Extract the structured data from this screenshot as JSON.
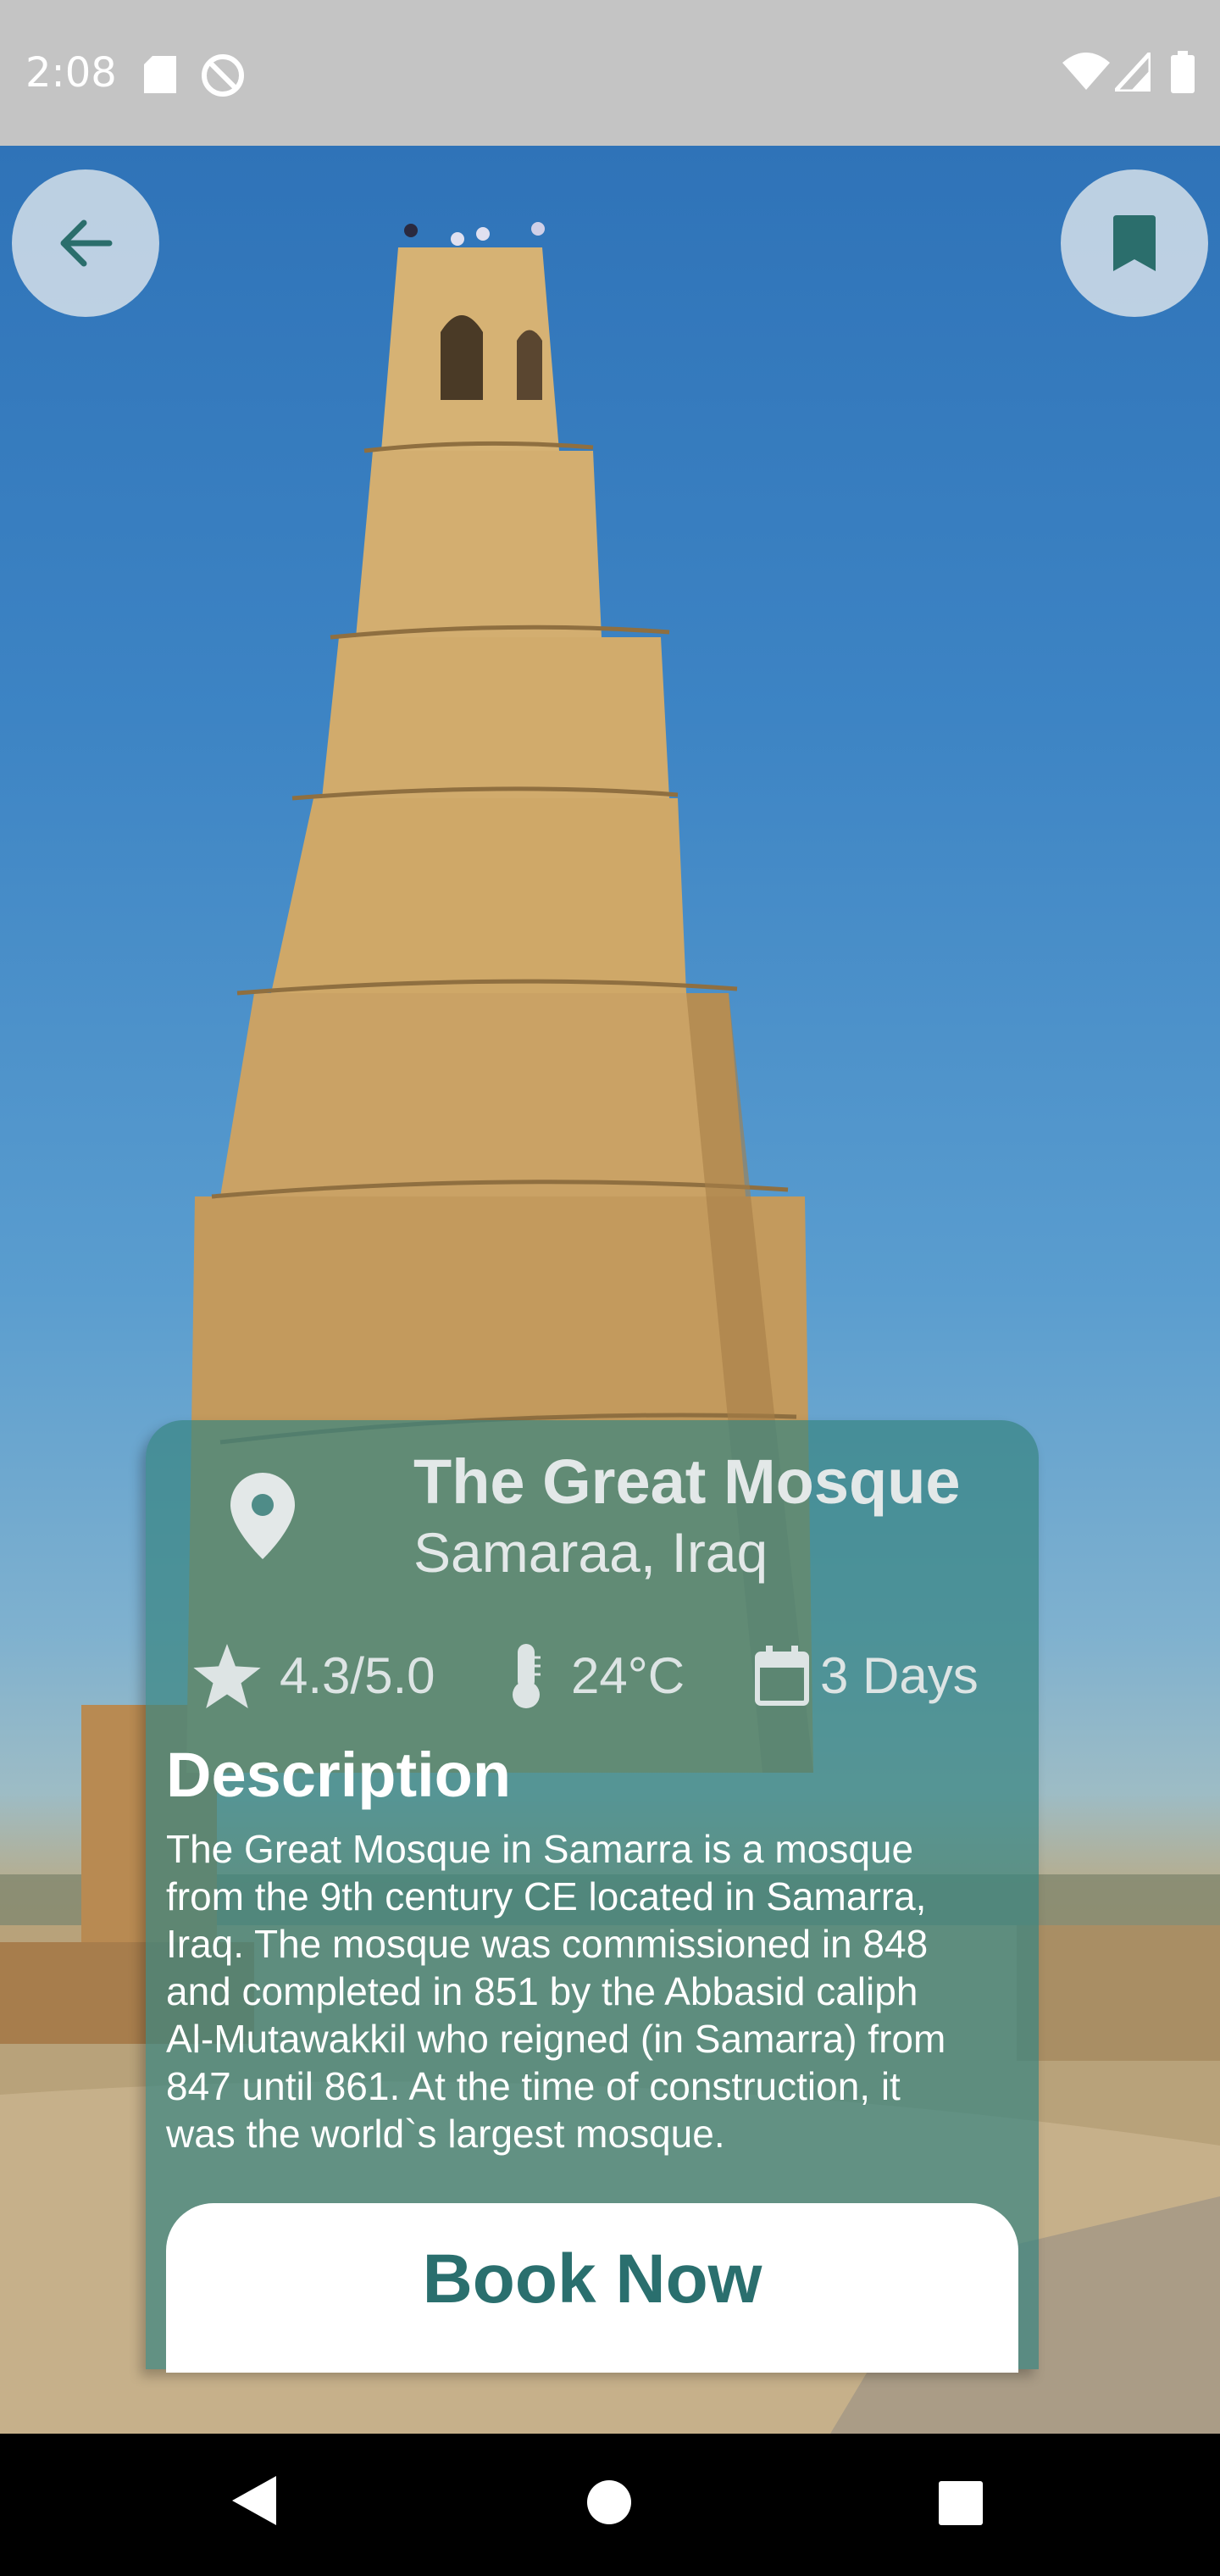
{
  "status_bar": {
    "time": "2:08",
    "icons": [
      "sd-card-icon",
      "do-not-disturb-icon",
      "wifi-icon",
      "signal-icon",
      "battery-icon"
    ]
  },
  "top_buttons": {
    "back_icon": "arrow-left-icon",
    "bookmark_icon": "bookmark-icon"
  },
  "place": {
    "name": "The Great Mosque",
    "location": "Samaraa, Iraq",
    "rating": "4.3/5.0",
    "temperature": "24°C",
    "duration": "3 Days"
  },
  "description": {
    "heading": "Description",
    "lines": [
      "The Great Mosque in Samarra is a mosque",
      "from the 9th century CE located in Samarra,",
      "Iraq. The mosque was commissioned in 848",
      "and completed in 851 by the Abbasid caliph",
      "Al-Mutawakkil who reigned (in Samarra) from",
      "847 until 861. At the time of construction, it",
      "was the world`s largest mosque."
    ]
  },
  "cta": {
    "label": "Book Now"
  },
  "nav_bar": {
    "icons": [
      "back-triangle-icon",
      "home-circle-icon",
      "recents-square-icon"
    ]
  },
  "colors": {
    "accent": "#2a6f6e",
    "card": "#388480",
    "status_bar": "#c4c4c4"
  }
}
